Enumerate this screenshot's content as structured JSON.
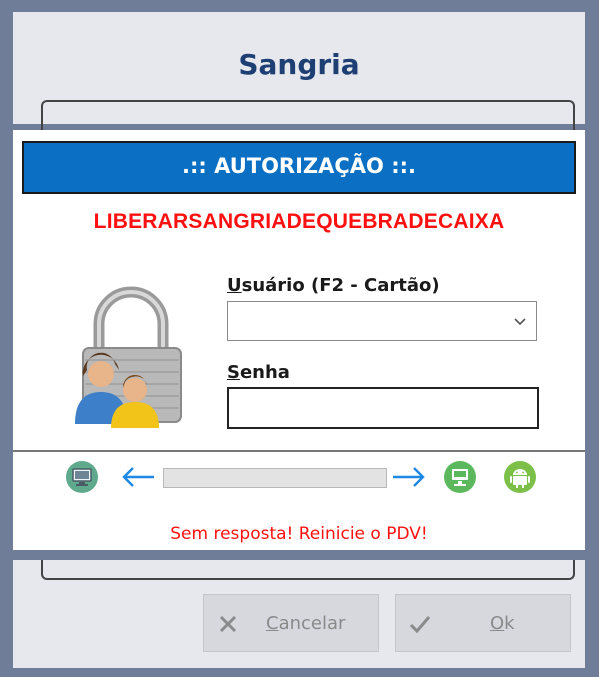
{
  "window": {
    "title": "Sangria"
  },
  "auth": {
    "header": ".:: AUTORIZAÇÃO ::.",
    "permission": "LIBERARSANGRIADEQUEBRADECAIXA",
    "user_label_accel": "U",
    "user_label_rest": "suário (F2 - Cartão)",
    "user_value": "",
    "password_label_accel": "S",
    "password_label_rest": "enha",
    "password_value": ""
  },
  "connection": {
    "progress": 0,
    "status": "Sem resposta! Reinicie o PDV!"
  },
  "buttons": {
    "cancel_accel": "C",
    "cancel_rest": "ancelar",
    "ok_accel": "O",
    "ok_rest": "k"
  },
  "icons": {
    "lock": "padlock-users-icon",
    "computer": "computer-icon",
    "arrow_left": "arrow-left-icon",
    "arrow_right": "arrow-right-icon",
    "pdv": "pdv-terminal-icon",
    "android": "android-icon",
    "cancel": "x-icon",
    "ok": "check-icon"
  },
  "colors": {
    "header_bg": "#0b6fc3",
    "alert": "#ff1010",
    "title": "#1d3f73",
    "icon_green": "#5cb85c",
    "arrow_blue": "#1e88e5"
  }
}
